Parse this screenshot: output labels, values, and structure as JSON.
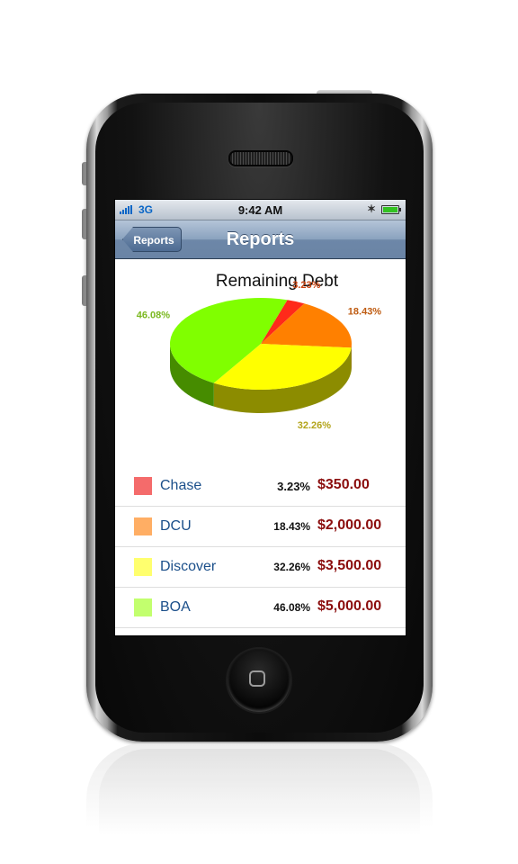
{
  "status_bar": {
    "network": "3G",
    "time": "9:42 AM"
  },
  "nav": {
    "back_label": "Reports",
    "title": "Reports"
  },
  "chart_data": {
    "type": "pie",
    "title": "Remaining Debt",
    "slices": [
      {
        "label": "Chase",
        "value": 3.23,
        "display": "3.23%",
        "color": "#ff2a1a",
        "label_color": "#cc4411"
      },
      {
        "label": "DCU",
        "value": 18.43,
        "display": "18.43%",
        "color": "#ff8000",
        "label_color": "#bf5c12"
      },
      {
        "label": "Discover",
        "value": 32.26,
        "display": "32.26%",
        "color": "#ffff00",
        "label_color": "#b3a41a"
      },
      {
        "label": "BOA",
        "value": 46.08,
        "display": "46.08%",
        "color": "#80ff00",
        "label_color": "#7ab81f"
      }
    ]
  },
  "legend": [
    {
      "name": "Chase",
      "percent": "3.23%",
      "amount": "$350.00",
      "color": "#f46b6b"
    },
    {
      "name": "DCU",
      "percent": "18.43%",
      "amount": "$2,000.00",
      "color": "#ffae64"
    },
    {
      "name": "Discover",
      "percent": "32.26%",
      "amount": "$3,500.00",
      "color": "#ffff6e"
    },
    {
      "name": "BOA",
      "percent": "46.08%",
      "amount": "$5,000.00",
      "color": "#c2ff6e"
    }
  ]
}
